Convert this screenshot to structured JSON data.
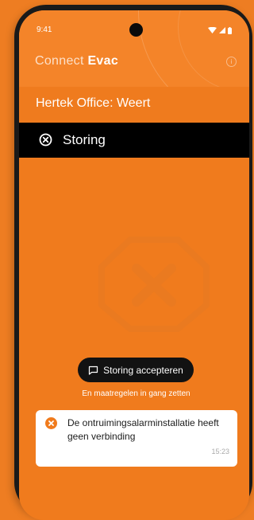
{
  "status_bar": {
    "time": "9:41"
  },
  "header": {
    "app_name_light": "Connect",
    "app_name_bold": "Evac",
    "info_icon": "info-icon"
  },
  "location": {
    "title": "Hertek Office: Weert"
  },
  "alarm": {
    "title": "Storing",
    "icon": "close-circle-icon"
  },
  "actions": {
    "accept_label": "Storing accepteren",
    "accept_subtext": "En maatregelen in gang zetten"
  },
  "notification": {
    "message": "De ontruimingsalarminstallatie heeft geen verbinding",
    "time": "15:23",
    "icon": "error-icon"
  },
  "colors": {
    "accent_orange": "#f07b1d",
    "alarm_bar": "#000000",
    "error_orange": "#f07b1d"
  }
}
